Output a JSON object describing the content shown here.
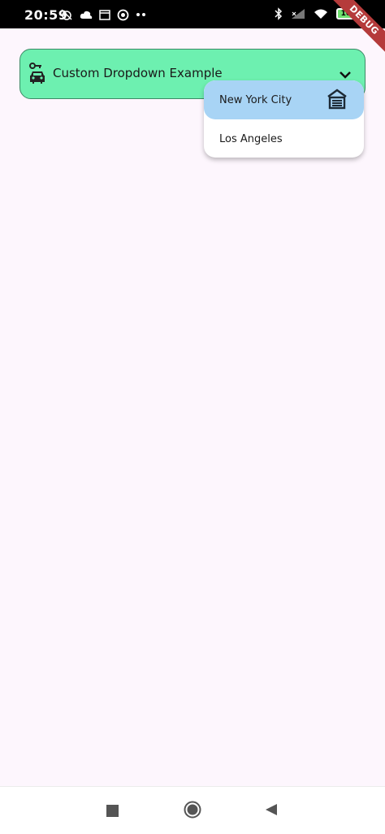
{
  "status_bar": {
    "time": "20:59",
    "battery": "100"
  },
  "debug_banner": {
    "label": "DEBUG"
  },
  "dropdown": {
    "label": "Custom Dropdown Example",
    "lead_icon": "car-key-icon",
    "trailing_icon": "chevron-down-icon"
  },
  "menu": {
    "items": [
      {
        "label": "New York City",
        "icon": "house-garage-icon",
        "selected": true
      },
      {
        "label": "Los Angeles",
        "selected": false
      }
    ]
  },
  "colors": {
    "header_bg": "#6df0b0",
    "selected_bg": "#a8d4f5",
    "page_bg": "#fdf6fd",
    "debug_red": "#b53b3b"
  }
}
